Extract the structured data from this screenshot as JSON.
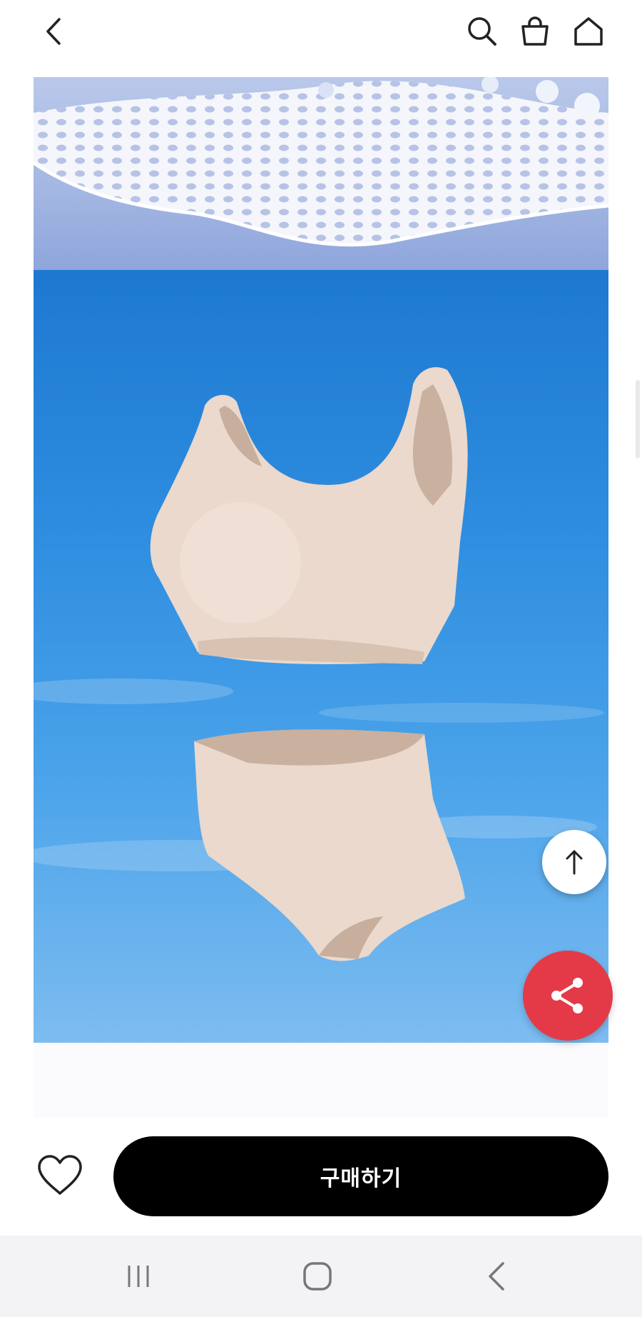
{
  "header": {
    "back_icon": "chevron-left-icon",
    "search_icon": "search-icon",
    "cart_icon": "shopping-bag-icon",
    "home_icon": "home-icon"
  },
  "product_images": [
    {
      "name": "mesh-fabric-closeup",
      "background": "#a3b6e2"
    },
    {
      "name": "bra-and-panty-set",
      "background": "#2f8ee0"
    }
  ],
  "floating": {
    "scroll_top_icon": "arrow-up-icon",
    "share_icon": "share-icon",
    "share_color": "#e43a48"
  },
  "purchase_bar": {
    "wishlist_icon": "heart-icon",
    "buy_label": "구매하기",
    "buy_color": "#000000"
  },
  "system_nav": {
    "recents_icon": "recents-icon",
    "home_icon": "home-circle-icon",
    "back_icon": "back-chevron-icon"
  }
}
